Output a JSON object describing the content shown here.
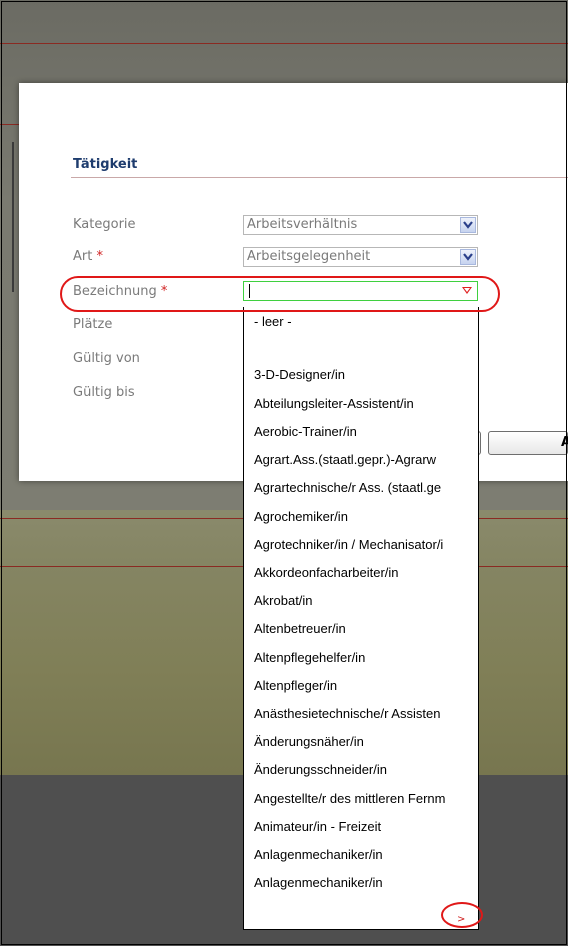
{
  "dialog": {
    "section_title": "Tätigkeit",
    "fields": {
      "kategorie": {
        "label": "Kategorie",
        "value": "Arbeitsverhältnis"
      },
      "art": {
        "label": "Art",
        "required": "*",
        "value": "Arbeitsgelegenheit"
      },
      "bezeichnung": {
        "label": "Bezeichnung",
        "required": "*",
        "value": ""
      },
      "plaetze": {
        "label": "Plätze"
      },
      "gueltig_von": {
        "label": "Gültig von"
      },
      "gueltig_bis": {
        "label": "Gültig bis"
      }
    },
    "buttons": {
      "second_label": "A"
    }
  },
  "dropdown": {
    "options": [
      "- leer -",
      "",
      "3-D-Designer/in",
      "Abteilungsleiter-Assistent/in",
      "Aerobic-Trainer/in",
      "Agrart.Ass.(staatl.gepr.)-Agrarw",
      "Agrartechnische/r Ass. (staatl.ge",
      "Agrochemiker/in",
      "Agrotechniker/in / Mechanisator/i",
      "Akkordeonfacharbeiter/in",
      "Akrobat/in",
      "Altenbetreuer/in",
      "Altenpflegehelfer/in",
      "Altenpfleger/in",
      "Anästhesietechnische/r Assisten",
      "Änderungsnäher/in",
      "Änderungsschneider/in",
      "Angestellte/r des mittleren Fernm",
      "Animateur/in - Freizeit",
      "Anlagenmechaniker/in",
      "Anlagenmechaniker/in"
    ],
    "more_symbol": ">"
  },
  "colors": {
    "annotation": "#e01818",
    "title": "#1e3c6e",
    "required": "#d02020",
    "focus_border": "#3fd03f"
  }
}
